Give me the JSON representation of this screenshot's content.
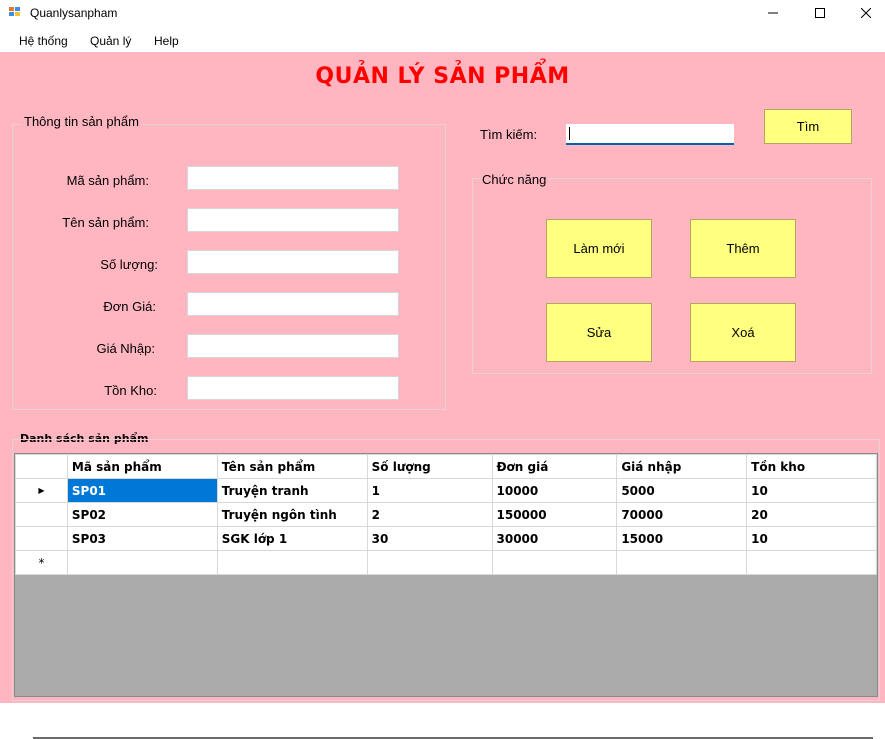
{
  "window": {
    "title": "Quanlysanpham"
  },
  "menu": [
    "Hệ thống",
    "Quản lý",
    "Help"
  ],
  "heading": "QUẢN LÝ SẢN PHẨM",
  "product_info": {
    "group_label": "Thông tin sản phẩm",
    "fields": [
      {
        "label": "Mã sản phẩm:",
        "value": ""
      },
      {
        "label": "Tên sản phẩm:",
        "value": ""
      },
      {
        "label": "Số lượng:",
        "value": ""
      },
      {
        "label": "Đơn Giá:",
        "value": ""
      },
      {
        "label": "Giá Nhập:",
        "value": ""
      },
      {
        "label": "Tồn Kho:",
        "value": ""
      }
    ]
  },
  "search": {
    "label": "Tìm kiếm:",
    "value": "",
    "button": "Tìm"
  },
  "functions": {
    "group_label": "Chức năng",
    "refresh": "Làm mới",
    "add": "Thêm",
    "edit": "Sửa",
    "delete": "Xoá"
  },
  "list": {
    "label": "Danh sách sản phẩm",
    "columns": [
      "Mã sản phẩm",
      "Tên sản phẩm",
      "Số lượng",
      "Đơn giá",
      "Giá nhập",
      "Tồn kho"
    ],
    "rows": [
      [
        "SP01",
        "Truyện tranh",
        "1",
        "10000",
        "5000",
        "10"
      ],
      [
        "SP02",
        "Truyện ngôn tình",
        "2",
        "150000",
        "70000",
        "20"
      ],
      [
        "SP03",
        "SGK lớp 1",
        "30",
        "30000",
        "15000",
        "10"
      ]
    ],
    "selected_row_marker": "▶",
    "new_row_marker": "*"
  },
  "colors": {
    "background": "#ffb6c1",
    "heading": "#ff0000",
    "button": "#ffff80",
    "selection": "#0078d7"
  },
  "icons": [
    "app-icon",
    "minimize-icon",
    "maximize-icon",
    "close-icon"
  ]
}
